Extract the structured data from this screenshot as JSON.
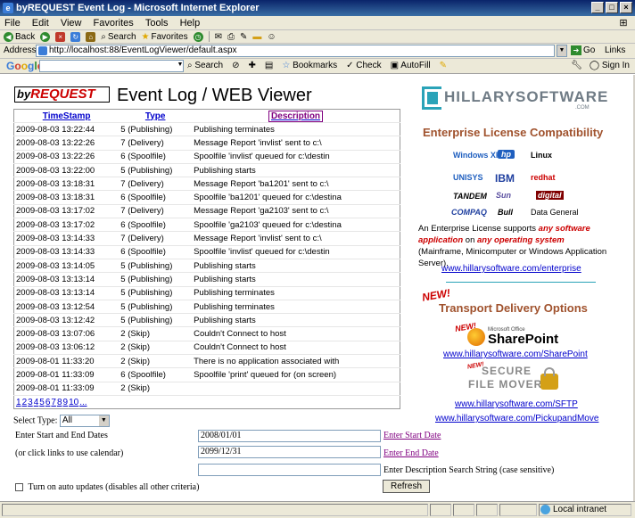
{
  "window": {
    "title": "byREQUEST Event Log - Microsoft Internet Explorer"
  },
  "menu": [
    "File",
    "Edit",
    "View",
    "Favorites",
    "Tools",
    "Help"
  ],
  "toolbar": {
    "back": "Back",
    "search": "Search",
    "favorites": "Favorites"
  },
  "address": {
    "label": "Address",
    "url": "http://localhost:88/EventLogViewer/default.aspx",
    "go": "Go",
    "links": "Links"
  },
  "google": {
    "logo": "Google",
    "search_btn": "Search",
    "bookmarks": "Bookmarks",
    "check": "Check",
    "autofill": "AutoFill",
    "sign_in": "Sign In"
  },
  "page": {
    "brand_by": "by",
    "brand_request": "REQUEST",
    "title": "Event Log / WEB Viewer"
  },
  "table": {
    "headers": {
      "timestamp": "TimeStamp",
      "type": "Type",
      "description": "Description"
    },
    "rows": [
      [
        "2009-08-03 13:22:44",
        "5 (Publishing)",
        "Publishing terminates"
      ],
      [
        "2009-08-03 13:22:26",
        "7 (Delivery)",
        "Message Report 'invlist' sent to c:\\"
      ],
      [
        "2009-08-03 13:22:26",
        "6 (Spoolfile)",
        "Spoolfile 'invlist' queued for c:\\destin"
      ],
      [
        "2009-08-03 13:22:00",
        "5 (Publishing)",
        "Publishing starts"
      ],
      [
        "2009-08-03 13:18:31",
        "7 (Delivery)",
        "Message Report 'ba1201' sent to c:\\"
      ],
      [
        "2009-08-03 13:18:31",
        "6 (Spoolfile)",
        "Spoolfile 'ba1201' queued for c:\\destina"
      ],
      [
        "2009-08-03 13:17:02",
        "7 (Delivery)",
        "Message Report 'ga2103' sent to c:\\"
      ],
      [
        "2009-08-03 13:17:02",
        "6 (Spoolfile)",
        "Spoolfile 'ga2103' queued for c:\\destina"
      ],
      [
        "2009-08-03 13:14:33",
        "7 (Delivery)",
        "Message Report 'invlist' sent to c:\\"
      ],
      [
        "2009-08-03 13:14:33",
        "6 (Spoolfile)",
        "Spoolfile 'invlist' queued for c:\\destin"
      ],
      [
        "2009-08-03 13:14:05",
        "5 (Publishing)",
        "Publishing starts"
      ],
      [
        "2009-08-03 13:13:14",
        "5 (Publishing)",
        "Publishing starts"
      ],
      [
        "2009-08-03 13:13:14",
        "5 (Publishing)",
        "Publishing terminates"
      ],
      [
        "2009-08-03 13:12:54",
        "5 (Publishing)",
        "Publishing terminates"
      ],
      [
        "2009-08-03 13:12:42",
        "5 (Publishing)",
        "Publishing starts"
      ],
      [
        "2009-08-03 13:07:06",
        "2 (Skip)",
        "Couldn't Connect to host"
      ],
      [
        "2009-08-03 13:06:12",
        "2 (Skip)",
        "Couldn't Connect to host"
      ],
      [
        "2009-08-01 11:33:20",
        "2 (Skip)",
        "There is no application associated with"
      ],
      [
        "2009-08-01 11:33:09",
        "6 (Spoolfile)",
        "Spoolfile 'print' queued for (on screen)"
      ],
      [
        "2009-08-01 11:33:09",
        "2 (Skip)",
        ""
      ]
    ],
    "pager": [
      "1",
      "2",
      "3",
      "4",
      "5",
      "6",
      "7",
      "8",
      "9",
      "10",
      "..."
    ]
  },
  "filters": {
    "select_type_label": "Select Type:",
    "select_type_value": "All",
    "dates_label": "Enter Start and End Dates",
    "calendar_hint": "(or click links to use calendar)",
    "start_date": "2008/01/01",
    "end_date": "2099/12/31",
    "start_link": "Enter Start Date",
    "end_link": "Enter End Date",
    "desc_label": "Enter Description Search String (case sensitive)",
    "auto_update_label": "Turn on auto updates (disables all other criteria)",
    "refresh": "Refresh"
  },
  "sidebar": {
    "logo_name": "HILLARYSOFTWARE",
    "logo_com": ".COM",
    "license_heading": "Enterprise License Compatibility",
    "vendors": [
      "Windows XP",
      "hp",
      "Linux",
      "UNISYS",
      "IBM",
      "redhat",
      "TANDEM",
      "Sun",
      "digital",
      "COMPAQ",
      "Bull",
      "Data General"
    ],
    "license_pre": "An Enterprise License supports ",
    "license_hl1": "any software application",
    "license_mid": " on ",
    "license_hl2": "any operating system",
    "license_post": " (Mainframe, Minicomputer or Windows Application Server).",
    "enterprise_link": "www.hillarysoftware.com/enterprise",
    "new_badge": "NEW!",
    "transport_heading": "Transport Delivery Options",
    "sp_new": "NEW!",
    "sp_ms": "Microsoft Office",
    "sp_name": "SharePoint",
    "sharepoint_link": "www.hillarysoftware.com/SharePoint",
    "sfm_new": "NEW!",
    "sfm_line1": "SECURE",
    "sfm_line2": "FILE MOVER",
    "sftp_link": "www.hillarysoftware.com/SFTP",
    "pickup_link": "www.hillarysoftware.com/PickupandMove"
  },
  "status": {
    "zone": "Local intranet"
  }
}
